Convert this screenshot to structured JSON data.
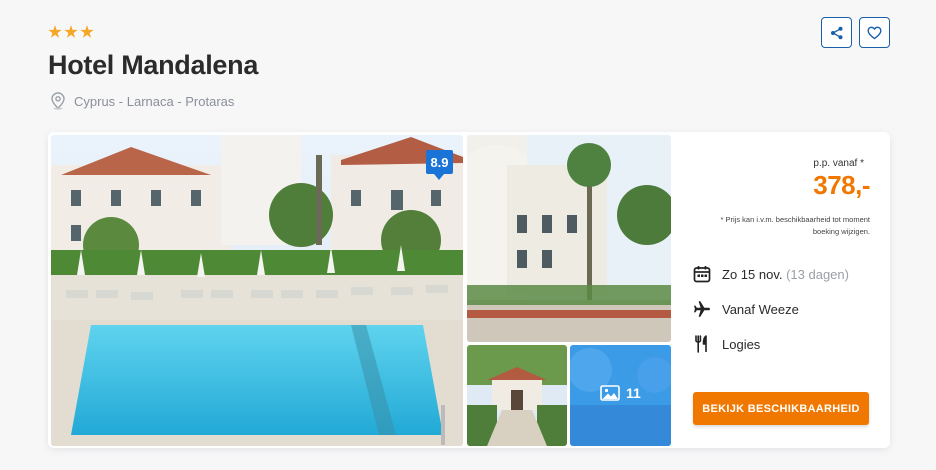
{
  "hotel": {
    "stars": 3,
    "name": "Hotel Mandalena",
    "location": "Cyprus - Larnaca - Protaras"
  },
  "actions": {
    "share_icon": "share-icon",
    "favorite_icon": "heart-icon"
  },
  "gallery": {
    "rating": "8.9",
    "photo_count": "11",
    "photos": [
      {
        "name": "hotel-pool-photo",
        "subject": "pool"
      },
      {
        "name": "hotel-facade-photo",
        "subject": "facade"
      },
      {
        "name": "hotel-entrance-photo",
        "subject": "entrance"
      },
      {
        "name": "more-photos-thumbnail",
        "subject": "more"
      }
    ]
  },
  "pricing": {
    "label": "p.p. vanaf *",
    "price": "378,-",
    "note": "* Prijs kan i.v.m. beschikbaarheid tot moment boeking wijzigen."
  },
  "details": {
    "date": "Zo 15 nov.",
    "duration": "(13 dagen)",
    "departure": "Vanaf Weeze",
    "board": "Logies"
  },
  "cta": {
    "label": "BEKIJK BESCHIKBAARHEID"
  },
  "colors": {
    "accent": "#f07800",
    "primary": "#1a5fa8",
    "rating_bg": "#1a73d6",
    "star": "#f5a623"
  }
}
